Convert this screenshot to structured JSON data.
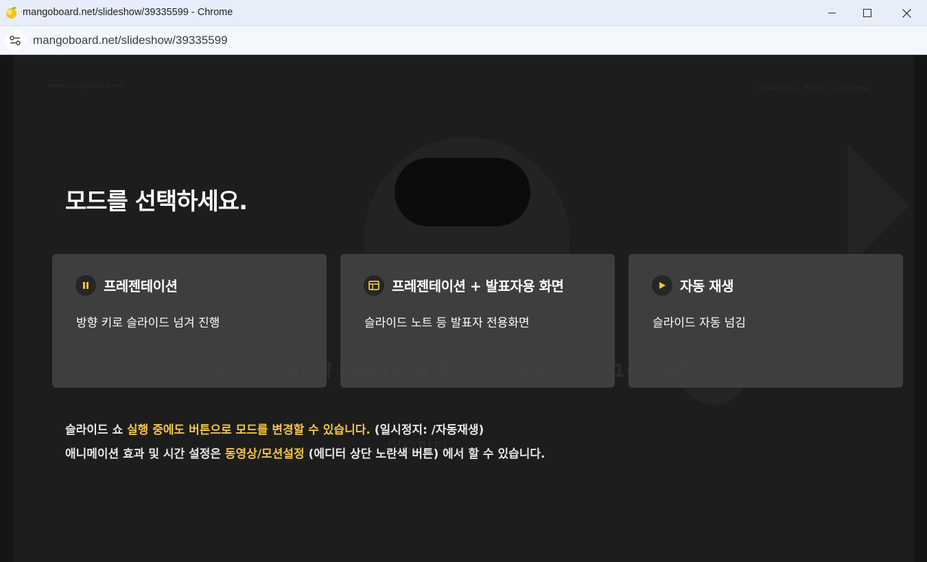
{
  "window": {
    "title": "mangoboard.net/slideshow/39335599 - Chrome",
    "url": "mangoboard.net/slideshow/39335599"
  },
  "colors": {
    "accent": "#f5c542",
    "card_bg": "#464646",
    "text": "#ffffff"
  },
  "background_slide": {
    "headline": "췌장암 항체신약 PBP1510 美 임상 본격화…\"연내 1상 완료\"",
    "subline": "…이오피피",
    "top_left": "www.mangoboard.net",
    "top_right": "2024.01.01 · 망고보드 · slideshow"
  },
  "modal": {
    "heading": "모드를 선택하세요.",
    "modes": [
      {
        "icon": "pause-icon",
        "title": "프레젠테이션",
        "description": "방향 키로 슬라이드 넘겨 진행"
      },
      {
        "icon": "presenter-view-icon",
        "title": "프레젠테이션 + 발표자용 화면",
        "description": "슬라이드 노트 등 발표자 전용화면"
      },
      {
        "icon": "play-icon",
        "title": "자동 재생",
        "description": "슬라이드 자동 넘김"
      }
    ],
    "note1": {
      "prefix": "슬라이드 쇼 ",
      "highlight": "실행 중에도 버튼으로 모드를 변경할 수 있습니다.",
      "suffix": " (일시정지: /자동재생)"
    },
    "note2": {
      "prefix": "애니메이션 효과 및 시간 설정은 ",
      "highlight": "동영상/모션설정",
      "suffix": " (에디터 상단 노란색 버튼) 에서 할 수 있습니다."
    }
  }
}
